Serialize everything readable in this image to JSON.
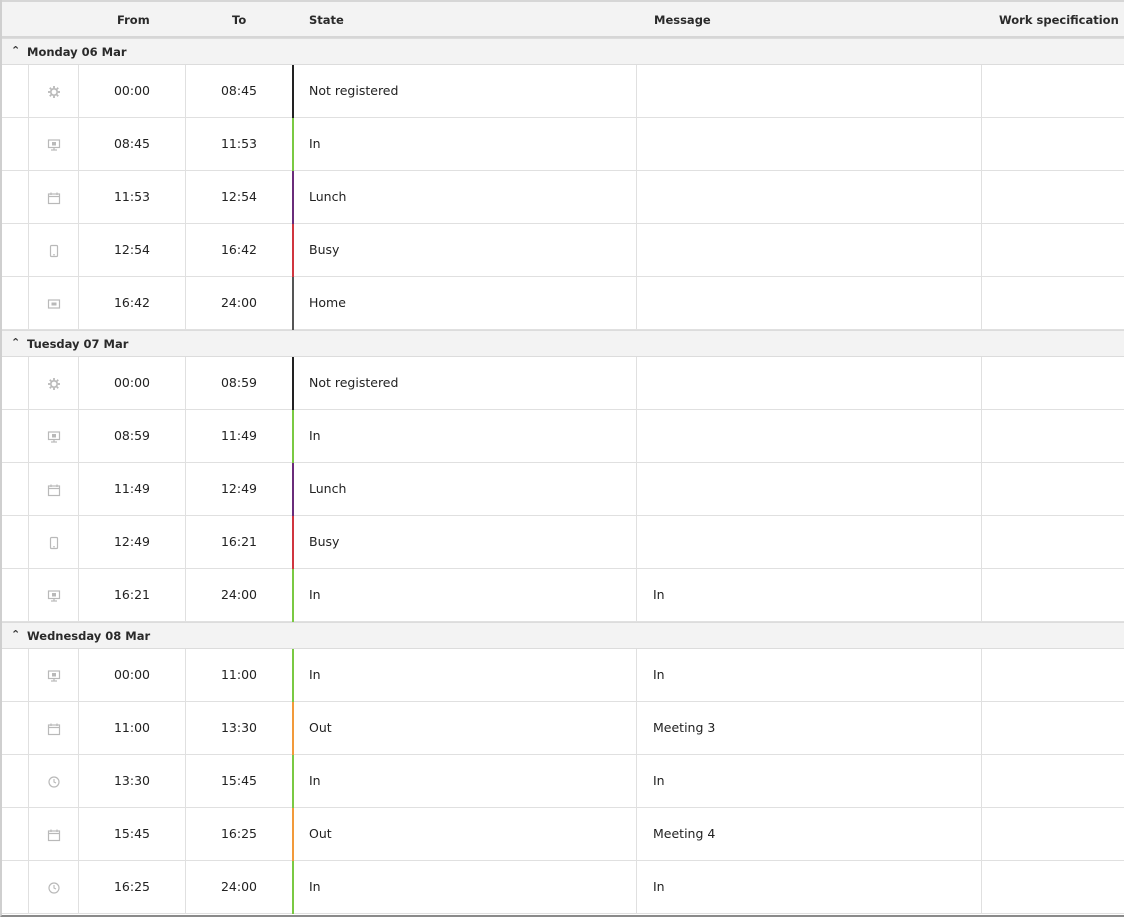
{
  "columns": {
    "from": "From",
    "to": "To",
    "state": "State",
    "message": "Message",
    "work_specification": "Work specification"
  },
  "state_colors": {
    "Not registered": "#222222",
    "In": "#7ac943",
    "Lunch": "#6a2c7a",
    "Busy": "#d0353f",
    "Home": "#555555",
    "Out": "#f29a3a"
  },
  "groups": [
    {
      "label": "Monday 06 Mar",
      "rows": [
        {
          "icon": "gear-icon",
          "from": "00:00",
          "to": "08:45",
          "state": "Not registered",
          "message": "",
          "work": ""
        },
        {
          "icon": "monitor-icon",
          "from": "08:45",
          "to": "11:53",
          "state": "In",
          "message": "",
          "work": ""
        },
        {
          "icon": "calendar-icon",
          "from": "11:53",
          "to": "12:54",
          "state": "Lunch",
          "message": "",
          "work": ""
        },
        {
          "icon": "phone-icon",
          "from": "12:54",
          "to": "16:42",
          "state": "Busy",
          "message": "",
          "work": ""
        },
        {
          "icon": "home-screen-icon",
          "from": "16:42",
          "to": "24:00",
          "state": "Home",
          "message": "",
          "work": ""
        }
      ]
    },
    {
      "label": "Tuesday 07 Mar",
      "rows": [
        {
          "icon": "gear-icon",
          "from": "00:00",
          "to": "08:59",
          "state": "Not registered",
          "message": "",
          "work": ""
        },
        {
          "icon": "monitor-icon",
          "from": "08:59",
          "to": "11:49",
          "state": "In",
          "message": "",
          "work": ""
        },
        {
          "icon": "calendar-icon",
          "from": "11:49",
          "to": "12:49",
          "state": "Lunch",
          "message": "",
          "work": ""
        },
        {
          "icon": "phone-icon",
          "from": "12:49",
          "to": "16:21",
          "state": "Busy",
          "message": "",
          "work": ""
        },
        {
          "icon": "monitor-icon",
          "from": "16:21",
          "to": "24:00",
          "state": "In",
          "message": "In",
          "work": ""
        }
      ]
    },
    {
      "label": "Wednesday 08 Mar",
      "rows": [
        {
          "icon": "monitor-icon",
          "from": "00:00",
          "to": "11:00",
          "state": "In",
          "message": "In",
          "work": ""
        },
        {
          "icon": "calendar-icon",
          "from": "11:00",
          "to": "13:30",
          "state": "Out",
          "message": "Meeting 3",
          "work": ""
        },
        {
          "icon": "clock-icon",
          "from": "13:30",
          "to": "15:45",
          "state": "In",
          "message": "In",
          "work": ""
        },
        {
          "icon": "calendar-icon",
          "from": "15:45",
          "to": "16:25",
          "state": "Out",
          "message": "Meeting 4",
          "work": ""
        },
        {
          "icon": "clock-icon",
          "from": "16:25",
          "to": "24:00",
          "state": "In",
          "message": "In",
          "work": ""
        }
      ]
    }
  ]
}
